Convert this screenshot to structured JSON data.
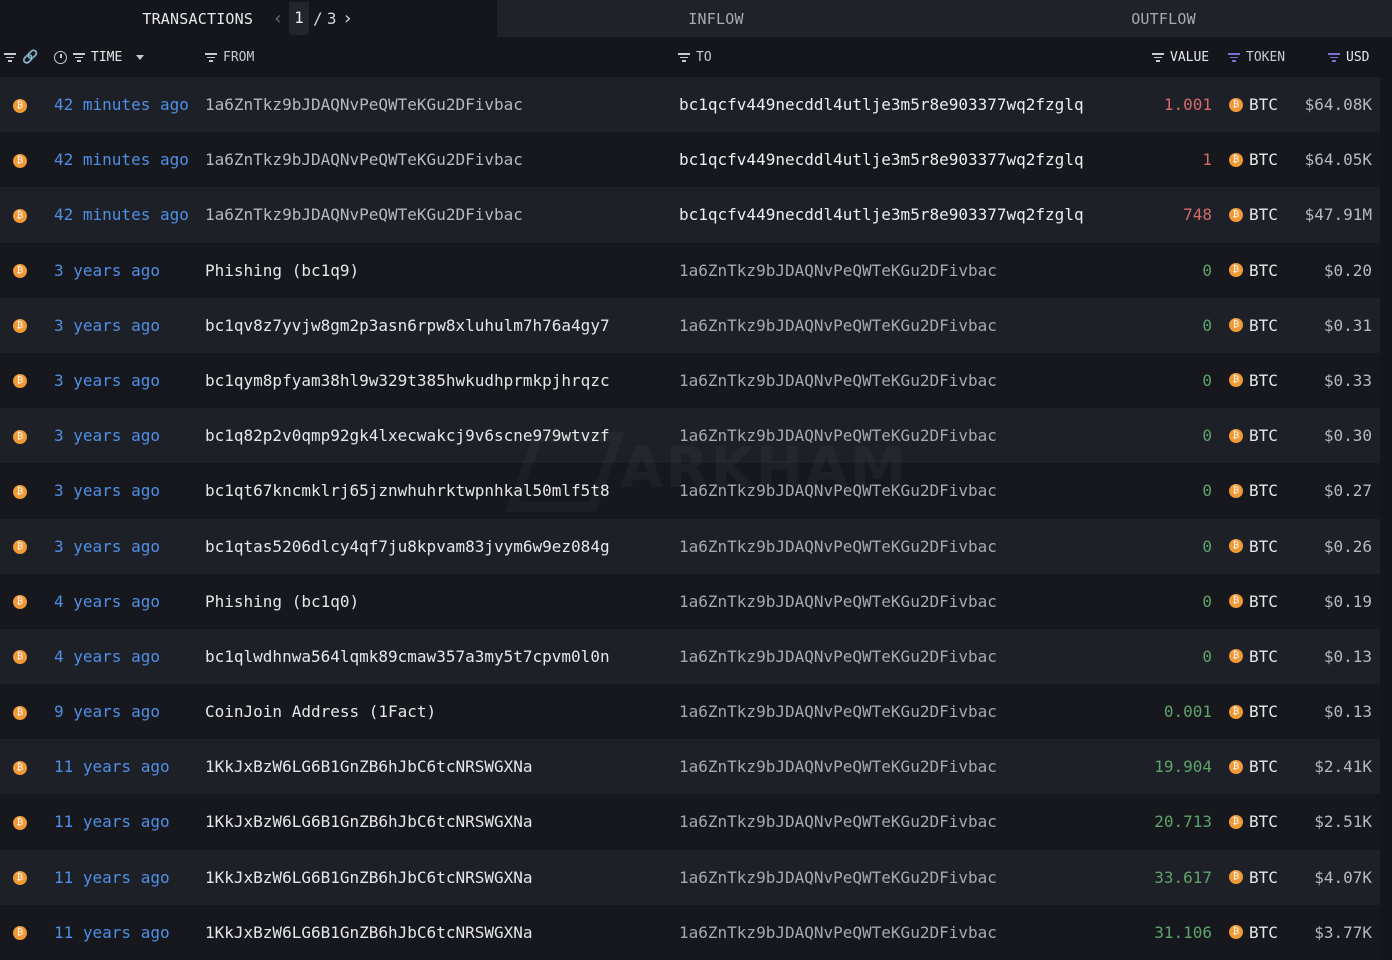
{
  "tabs": {
    "transactions": "TRANSACTIONS",
    "inflow": "INFLOW",
    "outflow": "OUTFLOW"
  },
  "pager": {
    "prev": "‹",
    "current": "1",
    "separator": "/",
    "total": "3",
    "next": "›"
  },
  "columns": {
    "time": "TIME",
    "from": "FROM",
    "to": "TO",
    "value": "VALUE",
    "token": "TOKEN",
    "usd": "USD"
  },
  "watermark": "ARKHAM",
  "colors": {
    "outflow_value": "#d26a6a",
    "inflow_value": "#5ea36b",
    "time_link": "#4f8fe6",
    "btc_orange": "#f09a37",
    "filter_active": "#7b6fd6"
  },
  "rows": [
    {
      "time": "42 minutes ago",
      "from": "1a6ZnTkz9bJDAQNvPeQWTeKGu2DFivbac",
      "to": "bc1qcfv449necddl4utlje3m5r8e903377wq2fzglq",
      "value": "1.001",
      "direction": "out",
      "token": "BTC",
      "usd": "$64.08K"
    },
    {
      "time": "42 minutes ago",
      "from": "1a6ZnTkz9bJDAQNvPeQWTeKGu2DFivbac",
      "to": "bc1qcfv449necddl4utlje3m5r8e903377wq2fzglq",
      "value": "1",
      "direction": "out",
      "token": "BTC",
      "usd": "$64.05K"
    },
    {
      "time": "42 minutes ago",
      "from": "1a6ZnTkz9bJDAQNvPeQWTeKGu2DFivbac",
      "to": "bc1qcfv449necddl4utlje3m5r8e903377wq2fzglq",
      "value": "748",
      "direction": "out",
      "token": "BTC",
      "usd": "$47.91M"
    },
    {
      "time": "3 years ago",
      "from": "Phishing (bc1q9)",
      "to": "1a6ZnTkz9bJDAQNvPeQWTeKGu2DFivbac",
      "value": "0",
      "direction": "in",
      "token": "BTC",
      "usd": "$0.20"
    },
    {
      "time": "3 years ago",
      "from": "bc1qv8z7yvjw8gm2p3asn6rpw8xluhulm7h76a4gy7",
      "to": "1a6ZnTkz9bJDAQNvPeQWTeKGu2DFivbac",
      "value": "0",
      "direction": "in",
      "token": "BTC",
      "usd": "$0.31"
    },
    {
      "time": "3 years ago",
      "from": "bc1qym8pfyam38hl9w329t385hwkudhprmkpjhrqzc",
      "to": "1a6ZnTkz9bJDAQNvPeQWTeKGu2DFivbac",
      "value": "0",
      "direction": "in",
      "token": "BTC",
      "usd": "$0.33"
    },
    {
      "time": "3 years ago",
      "from": "bc1q82p2v0qmp92gk4lxecwakcj9v6scne979wtvzf",
      "to": "1a6ZnTkz9bJDAQNvPeQWTeKGu2DFivbac",
      "value": "0",
      "direction": "in",
      "token": "BTC",
      "usd": "$0.30"
    },
    {
      "time": "3 years ago",
      "from": "bc1qt67kncmklrj65jznwhuhrktwpnhkal50mlf5t8",
      "to": "1a6ZnTkz9bJDAQNvPeQWTeKGu2DFivbac",
      "value": "0",
      "direction": "in",
      "token": "BTC",
      "usd": "$0.27"
    },
    {
      "time": "3 years ago",
      "from": "bc1qtas5206dlcy4qf7ju8kpvam83jvym6w9ez084g",
      "to": "1a6ZnTkz9bJDAQNvPeQWTeKGu2DFivbac",
      "value": "0",
      "direction": "in",
      "token": "BTC",
      "usd": "$0.26"
    },
    {
      "time": "4 years ago",
      "from": "Phishing (bc1q0)",
      "to": "1a6ZnTkz9bJDAQNvPeQWTeKGu2DFivbac",
      "value": "0",
      "direction": "in",
      "token": "BTC",
      "usd": "$0.19"
    },
    {
      "time": "4 years ago",
      "from": "bc1qlwdhnwa564lqmk89cmaw357a3my5t7cpvm0l0n",
      "to": "1a6ZnTkz9bJDAQNvPeQWTeKGu2DFivbac",
      "value": "0",
      "direction": "in",
      "token": "BTC",
      "usd": "$0.13"
    },
    {
      "time": "9 years ago",
      "from": "CoinJoin Address (1Fact)",
      "to": "1a6ZnTkz9bJDAQNvPeQWTeKGu2DFivbac",
      "value": "0.001",
      "direction": "in",
      "token": "BTC",
      "usd": "$0.13"
    },
    {
      "time": "11 years ago",
      "from": "1KkJxBzW6LG6B1GnZB6hJbC6tcNRSWGXNa",
      "to": "1a6ZnTkz9bJDAQNvPeQWTeKGu2DFivbac",
      "value": "19.904",
      "direction": "in",
      "token": "BTC",
      "usd": "$2.41K"
    },
    {
      "time": "11 years ago",
      "from": "1KkJxBzW6LG6B1GnZB6hJbC6tcNRSWGXNa",
      "to": "1a6ZnTkz9bJDAQNvPeQWTeKGu2DFivbac",
      "value": "20.713",
      "direction": "in",
      "token": "BTC",
      "usd": "$2.51K"
    },
    {
      "time": "11 years ago",
      "from": "1KkJxBzW6LG6B1GnZB6hJbC6tcNRSWGXNa",
      "to": "1a6ZnTkz9bJDAQNvPeQWTeKGu2DFivbac",
      "value": "33.617",
      "direction": "in",
      "token": "BTC",
      "usd": "$4.07K"
    },
    {
      "time": "11 years ago",
      "from": "1KkJxBzW6LG6B1GnZB6hJbC6tcNRSWGXNa",
      "to": "1a6ZnTkz9bJDAQNvPeQWTeKGu2DFivbac",
      "value": "31.106",
      "direction": "in",
      "token": "BTC",
      "usd": "$3.77K"
    }
  ]
}
